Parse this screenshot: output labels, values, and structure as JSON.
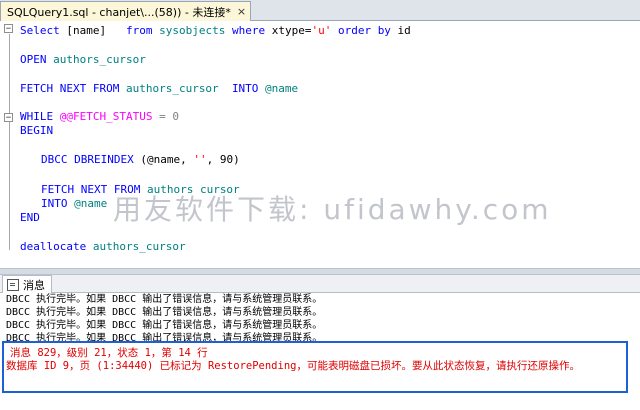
{
  "tab": {
    "title": "SQLQuery1.sql - chanjet\\...(58)) - 未连接*",
    "close": "×"
  },
  "code": {
    "l1": {
      "a": "Select",
      "b": " [name]   ",
      "c": "from",
      "d": " sysobjects ",
      "e": "where",
      "f": " xtype=",
      "g": "'u'",
      "h": " ",
      "i": "order by",
      "j": " id"
    },
    "l2": {
      "a": "OPEN",
      "b": " authors_cursor"
    },
    "l3": {
      "a": "FETCH NEXT FROM",
      "b": " authors_cursor  ",
      "c": "INTO",
      "d": " @name"
    },
    "l4": {
      "a": "WHILE",
      "b": " @@FETCH_STATUS",
      "c": " = 0"
    },
    "l5": {
      "a": "BEGIN"
    },
    "l6": {
      "a": "DBCC DBREINDEX",
      "b": " (@name, ",
      "c": "''",
      "d": ", 90)"
    },
    "l7": {
      "a": "FETCH NEXT FROM",
      "b": " authors cursor"
    },
    "l8": {
      "a": "INTO",
      "b": " @name"
    },
    "l9": {
      "a": "END"
    },
    "l10": {
      "a": "deallocate",
      "b": " authors_cursor"
    }
  },
  "watermark": "用友软件下载: ufidawhy.com",
  "panel": {
    "tab_label": "消息"
  },
  "messages": [
    "DBCC 执行完毕。如果 DBCC 输出了错误信息，请与系统管理员联系。",
    "DBCC 执行完毕。如果 DBCC 输出了错误信息，请与系统管理员联系。",
    "DBCC 执行完毕。如果 DBCC 输出了错误信息，请与系统管理员联系。",
    "DBCC 执行完毕。如果 DBCC 输出了错误信息，请与系统管理员联系。"
  ],
  "error": {
    "line1": "消息 829，级别 21，状态 1，第 14 行",
    "line2": "数据库 ID 9，页 (1:34440) 已标记为 RestorePending，可能表明磁盘已损坏。要从此状态恢复，请执行还原操作。"
  },
  "colors": {
    "keyword": "#0000ff",
    "identifier": "#008080",
    "string": "#ff0000",
    "system": "#ff00ff",
    "error": "#e00000",
    "highlight_box": "#1e5fd6"
  }
}
